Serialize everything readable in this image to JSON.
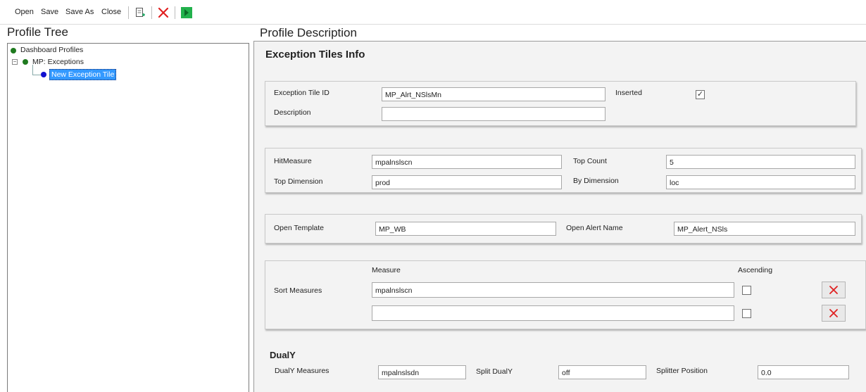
{
  "toolbar": {
    "open_label": "Open",
    "save_label": "Save",
    "save_as_label": "Save As",
    "close_label": "Close"
  },
  "tree": {
    "title": "Profile Tree",
    "root": "Dashboard Profiles",
    "child": "MP: Exceptions",
    "selected": "New Exception Tile"
  },
  "description": {
    "title": "Profile Description",
    "section_title": "Exception Tiles Info",
    "tile": {
      "id_label": "Exception Tile ID",
      "id_value": "MP_Alrt_NSlsMn",
      "inserted_label": "Inserted",
      "inserted_checked": true,
      "description_label": "Description",
      "description_value": ""
    },
    "measures": {
      "hit_measure_label": "HitMeasure",
      "hit_measure_value": "mpalnslscn",
      "top_count_label": "Top Count",
      "top_count_value": "5",
      "top_dimension_label": "Top Dimension",
      "top_dimension_value": "prod",
      "by_dimension_label": "By Dimension",
      "by_dimension_value": "loc"
    },
    "template": {
      "open_template_label": "Open Template",
      "open_template_value": "MP_WB",
      "open_alert_label": "Open Alert Name",
      "open_alert_value": "MP_Alert_NSls"
    },
    "sort": {
      "label": "Sort Measures",
      "measure_header": "Measure",
      "ascending_header": "Ascending",
      "rows": [
        {
          "measure": "mpalnslscn",
          "ascending": false
        },
        {
          "measure": "",
          "ascending": false
        }
      ]
    },
    "dualy": {
      "title": "DualY",
      "measures_label": "DualY Measures",
      "measures_value": "mpalnslsdn",
      "split_label": "Split DualY",
      "split_value": "off",
      "splitter_label": "Splitter Position",
      "splitter_value": "0.0"
    }
  }
}
